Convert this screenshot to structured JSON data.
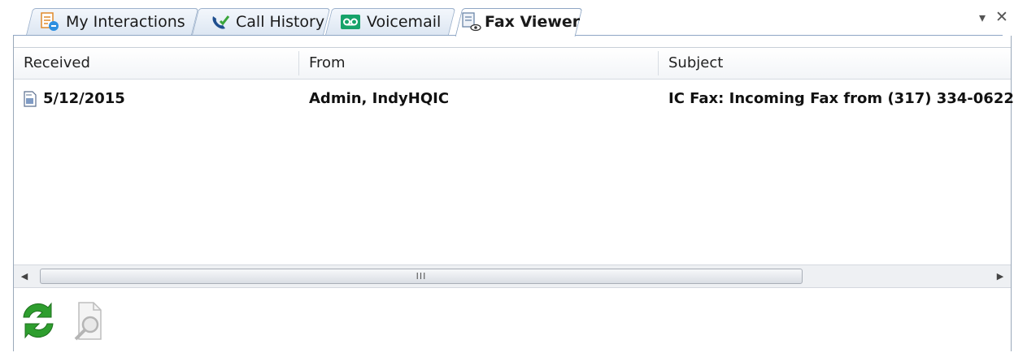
{
  "tabs": [
    {
      "label": "My Interactions",
      "icon": "my-interactions-icon",
      "active": false
    },
    {
      "label": "Call History",
      "icon": "call-history-icon",
      "active": false
    },
    {
      "label": "Voicemail",
      "icon": "voicemail-icon",
      "active": false
    },
    {
      "label": "Fax Viewer",
      "icon": "fax-viewer-icon",
      "active": true
    }
  ],
  "window_controls": {
    "menu_glyph": "▾",
    "close_glyph": "✕"
  },
  "table": {
    "columns": [
      "Received",
      "From",
      "Subject"
    ],
    "rows": [
      {
        "received": "5/12/2015",
        "from": "Admin, IndyHQIC",
        "subject": "IC Fax: Incoming Fax from (317) 334-0622",
        "icon": "fax-document-icon"
      }
    ]
  },
  "scrollbar": {
    "left_arrow": "◀",
    "right_arrow": "▶",
    "grip": "III"
  },
  "toolbar": [
    {
      "name": "refresh-button",
      "icon": "refresh-icon",
      "enabled": true
    },
    {
      "name": "view-fax-button",
      "icon": "magnifier-document-icon",
      "enabled": false
    }
  ],
  "colors": {
    "accent_tab_border": "#8ea6c4",
    "refresh_green": "#2e9e2e"
  }
}
